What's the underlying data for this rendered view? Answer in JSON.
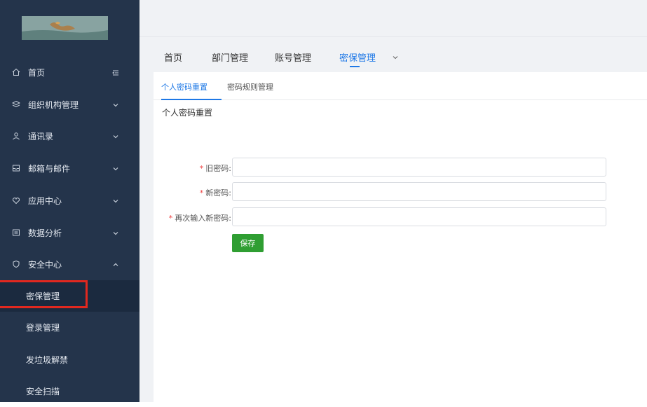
{
  "sidebar": {
    "logo_icon": "landscape-logo",
    "menu": [
      {
        "label": "首页",
        "icon": "home-icon",
        "trailing": "collapse-icon"
      },
      {
        "label": "组织机构管理",
        "icon": "layers-icon",
        "trailing": "chevron-down-icon"
      },
      {
        "label": "通讯录",
        "icon": "contacts-icon",
        "trailing": "chevron-down-icon"
      },
      {
        "label": "邮箱与邮件",
        "icon": "mail-icon",
        "trailing": "chevron-down-icon"
      },
      {
        "label": "应用中心",
        "icon": "app-icon",
        "trailing": "chevron-down-icon"
      },
      {
        "label": "数据分析",
        "icon": "chart-icon",
        "trailing": "chevron-down-icon"
      },
      {
        "label": "安全中心",
        "icon": "shield-icon",
        "trailing": "chevron-up-icon"
      }
    ],
    "submenu": [
      {
        "label": "密保管理",
        "active": true
      },
      {
        "label": "登录管理",
        "active": false
      },
      {
        "label": "发垃圾解禁",
        "active": false
      },
      {
        "label": "安全扫描",
        "active": false
      }
    ]
  },
  "top_tabs": [
    {
      "label": "首页",
      "active": false
    },
    {
      "label": "部门管理",
      "active": false
    },
    {
      "label": "账号管理",
      "active": false
    },
    {
      "label": "密保管理",
      "active": true
    }
  ],
  "sub_tabs": [
    {
      "label": "个人密码重置",
      "active": true
    },
    {
      "label": "密码规则管理",
      "active": false
    }
  ],
  "form": {
    "title": "个人密码重置",
    "fields": [
      {
        "required_mark": "*",
        "label": "旧密码:",
        "value": ""
      },
      {
        "required_mark": "*",
        "label": "新密码:",
        "value": ""
      },
      {
        "required_mark": "*",
        "label": "再次输入新密码:",
        "value": ""
      }
    ],
    "save_label": "保存"
  },
  "colors": {
    "sidebar_bg": "#24344b",
    "accent": "#1e78e6",
    "save_button": "#2f9e32",
    "highlight": "#e1281f",
    "required": "#ef4444"
  }
}
